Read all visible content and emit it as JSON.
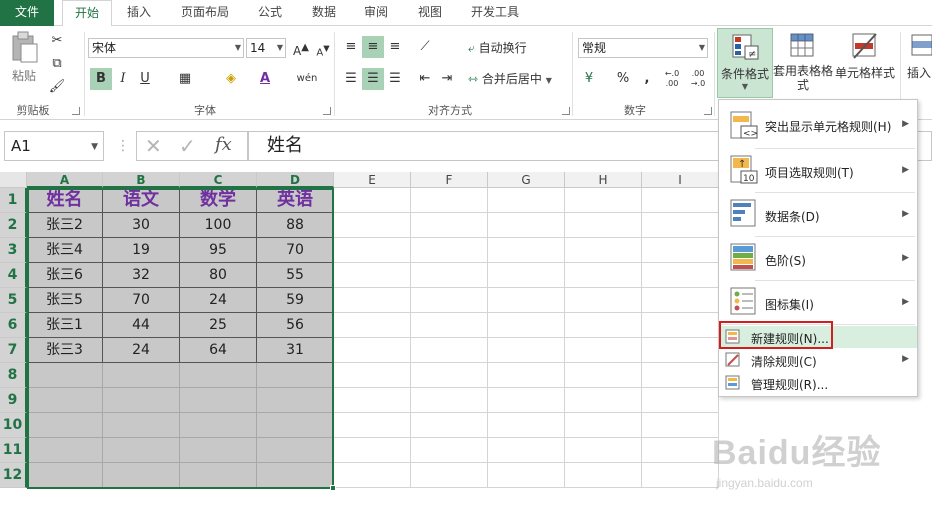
{
  "tabs": [
    {
      "label": "文件",
      "file": true
    },
    {
      "label": "开始",
      "active": true
    },
    {
      "label": "插入"
    },
    {
      "label": "页面布局"
    },
    {
      "label": "公式"
    },
    {
      "label": "数据"
    },
    {
      "label": "审阅"
    },
    {
      "label": "视图"
    },
    {
      "label": "开发工具"
    }
  ],
  "ribbon": {
    "clipboard": {
      "paste_label": "粘贴",
      "group_label": "剪贴板"
    },
    "font": {
      "font_name": "宋体",
      "font_size": "14",
      "group_label": "字体",
      "bold": "B",
      "italic": "I",
      "underline": "U"
    },
    "alignment": {
      "wrap_label": "自动换行",
      "merge_label": "合并后居中",
      "group_label": "对齐方式"
    },
    "number": {
      "format": "常规",
      "percent": "%",
      "comma": ",",
      "dec_inc": "←.0 .00",
      "dec_dec": ".00 →.0",
      "group_label": "数字"
    },
    "styles": {
      "cond_format_label": "条件格式",
      "table_format_label": "套用表格格式",
      "cell_styles_label": "单元格样式"
    },
    "cells": {
      "insert_label": "插入"
    }
  },
  "formula_bar": {
    "name_box": "A1",
    "content": "姓名",
    "fx": "fx"
  },
  "columns": [
    "A",
    "B",
    "C",
    "D",
    "E",
    "F",
    "G",
    "H",
    "I"
  ],
  "rows": [
    "1",
    "2",
    "3",
    "4",
    "5",
    "6",
    "7",
    "8",
    "9",
    "10",
    "11",
    "12"
  ],
  "cells": {
    "header": [
      "姓名",
      "语文",
      "数学",
      "英语"
    ],
    "data": [
      [
        "张三2",
        "30",
        "100",
        "88"
      ],
      [
        "张三4",
        "19",
        "95",
        "70"
      ],
      [
        "张三6",
        "32",
        "80",
        "55"
      ],
      [
        "张三5",
        "70",
        "24",
        "59"
      ],
      [
        "张三1",
        "44",
        "25",
        "56"
      ],
      [
        "张三3",
        "24",
        "64",
        "31"
      ]
    ]
  },
  "dropdown": {
    "items": [
      {
        "label": "突出显示单元格规则(H)",
        "icon": "highlight-cells-icon"
      },
      {
        "label": "项目选取规则(T)",
        "icon": "top-bottom-icon"
      },
      {
        "label": "数据条(D)",
        "icon": "data-bars-icon"
      },
      {
        "label": "色阶(S)",
        "icon": "color-scales-icon"
      },
      {
        "label": "图标集(I)",
        "icon": "icon-sets-icon"
      },
      {
        "label": "新建规则(N)...",
        "icon": "new-rule-icon"
      },
      {
        "label": "清除规则(C)",
        "icon": "clear-rules-icon"
      },
      {
        "label": "管理规则(R)...",
        "icon": "manage-rules-icon"
      }
    ]
  },
  "colors": {
    "accent": "#217346",
    "header_text": "#7030a0",
    "selection_fill": "#c8c8c8",
    "highlight_box": "#d11f1f"
  },
  "watermark": {
    "brand": "Baidu经验",
    "url": "jingyan.baidu.com"
  }
}
